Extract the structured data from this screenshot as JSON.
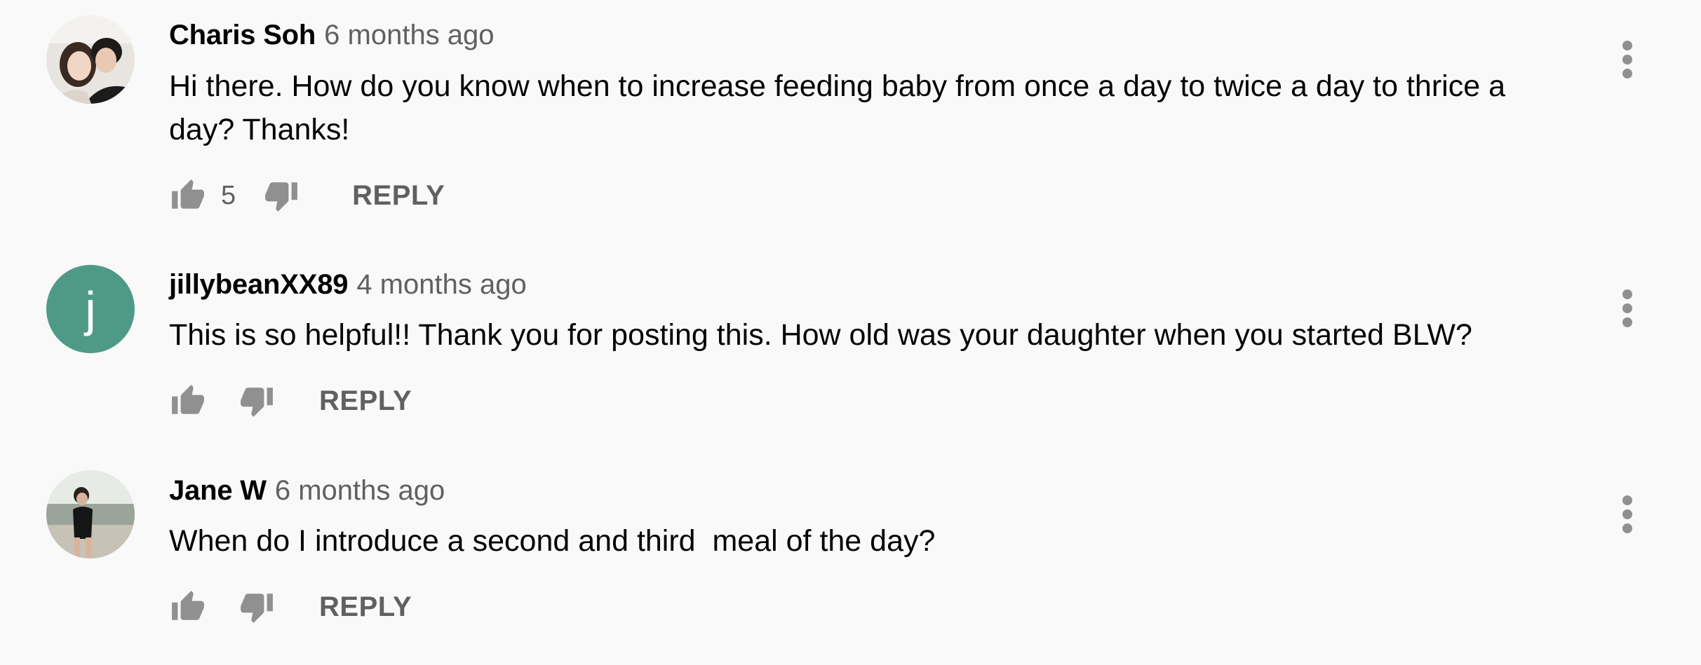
{
  "comments": [
    {
      "author": "Charis Soh",
      "time": "6 months ago",
      "text": "Hi there. How do you know when to increase feeding baby from once a day to twice a day to thrice a day? Thanks!",
      "likes": "5",
      "reply_label": "REPLY",
      "avatar": "photo-avatar"
    },
    {
      "author": "jillybeanXX89",
      "time": "4 months ago",
      "text": "This is so helpful!! Thank you for posting this. How old was your daughter when you started BLW?",
      "likes": "",
      "reply_label": "REPLY",
      "avatar_letter": "j",
      "avatar_color": "#4f9a87"
    },
    {
      "author": "Jane W",
      "time": "6 months ago",
      "text": "When do I introduce a second and third  meal of the day?",
      "likes": "",
      "reply_label": "REPLY",
      "avatar": "photo-avatar"
    }
  ],
  "icons": {
    "like": "thumbs-up-icon",
    "dislike": "thumbs-down-icon",
    "menu": "more-vertical-icon"
  },
  "colors": {
    "background": "#f9f9f9",
    "text": "#030303",
    "secondary": "#606060",
    "icon": "#909090"
  }
}
